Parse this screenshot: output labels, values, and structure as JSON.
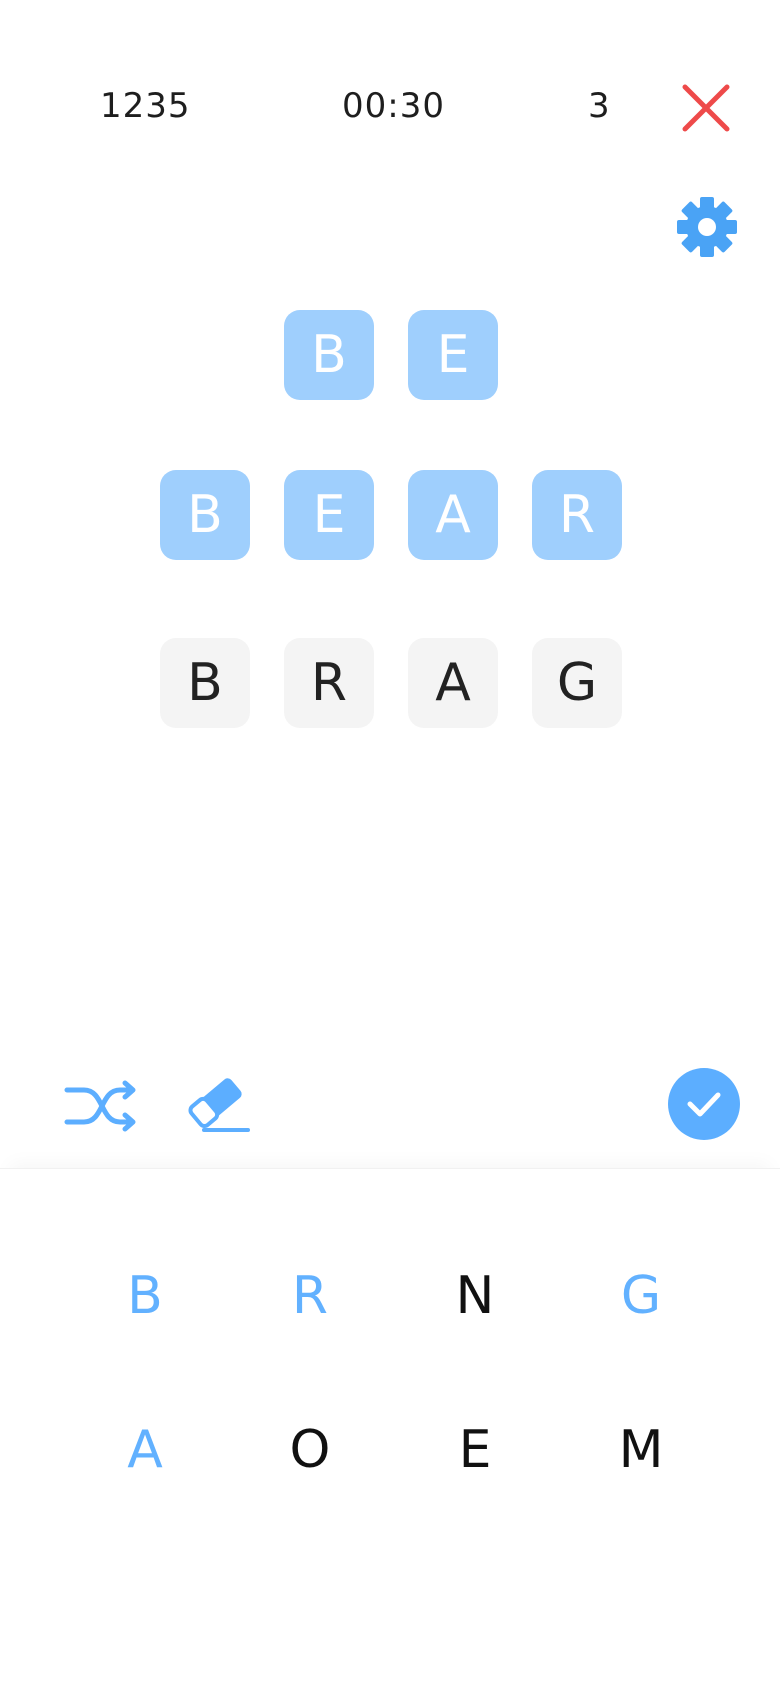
{
  "header": {
    "score": "1235",
    "timer": "00:30",
    "lives": "3"
  },
  "icons": {
    "close": "close-icon",
    "settings": "gear-icon",
    "shuffle": "shuffle-icon",
    "eraser": "eraser-icon",
    "submit": "check-icon"
  },
  "colors": {
    "accent": "#5caeff",
    "tile_solved": "#9fcffd",
    "tile_current": "#f4f4f4",
    "close": "#ee4a4a"
  },
  "words": [
    {
      "letters": [
        "B",
        "E"
      ],
      "state": "solved"
    },
    {
      "letters": [
        "B",
        "E",
        "A",
        "R"
      ],
      "state": "solved"
    },
    {
      "letters": [
        "B",
        "R",
        "A",
        "G"
      ],
      "state": "current"
    }
  ],
  "keyboard": {
    "row1": [
      {
        "letter": "B",
        "used": true
      },
      {
        "letter": "R",
        "used": true
      },
      {
        "letter": "N",
        "used": false
      },
      {
        "letter": "G",
        "used": true
      }
    ],
    "row2": [
      {
        "letter": "A",
        "used": true
      },
      {
        "letter": "O",
        "used": false
      },
      {
        "letter": "E",
        "used": false
      },
      {
        "letter": "M",
        "used": false
      }
    ]
  }
}
